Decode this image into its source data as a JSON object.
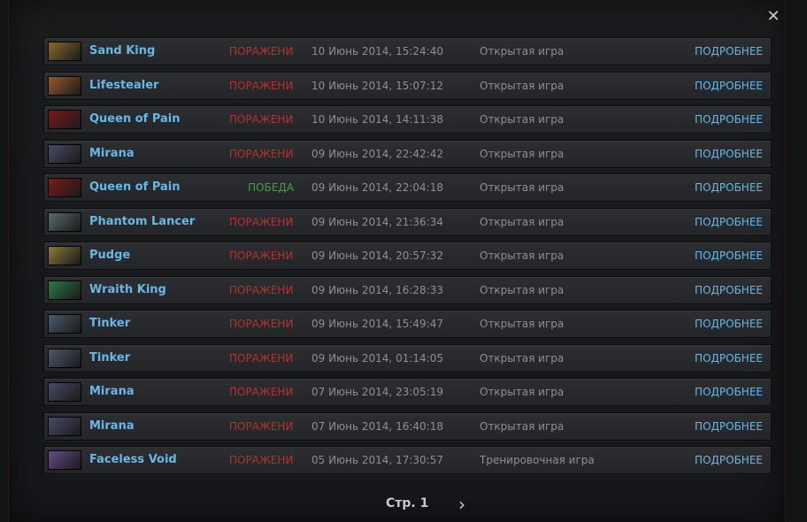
{
  "close_label": "✕",
  "rows": [
    {
      "hero": "Sand King",
      "result": "ПОРАЖЕНИЕ",
      "outcome": "loss",
      "date": "10 Июнь 2014, 15:24:40",
      "mode": "Открытая игра",
      "details": "ПОДРОБНЕЕ",
      "portrait_color": "#8a6a2a"
    },
    {
      "hero": "Lifestealer",
      "result": "ПОРАЖЕНИЕ",
      "outcome": "loss",
      "date": "10 Июнь 2014, 15:07:12",
      "mode": "Открытая игра",
      "details": "ПОДРОБНЕЕ",
      "portrait_color": "#9a5a2a"
    },
    {
      "hero": "Queen of Pain",
      "result": "ПОРАЖЕНИЕ",
      "outcome": "loss",
      "date": "10 Июнь 2014, 14:11:38",
      "mode": "Открытая игра",
      "details": "ПОДРОБНЕЕ",
      "portrait_color": "#7a1a1a"
    },
    {
      "hero": "Mirana",
      "result": "ПОРАЖЕНИЕ",
      "outcome": "loss",
      "date": "09 Июнь 2014, 22:42:42",
      "mode": "Открытая игра",
      "details": "ПОДРОБНЕЕ",
      "portrait_color": "#4a4a6a"
    },
    {
      "hero": "Queen of Pain",
      "result": "ПОБЕДА",
      "outcome": "win",
      "date": "09 Июнь 2014, 22:04:18",
      "mode": "Открытая игра",
      "details": "ПОДРОБНЕЕ",
      "portrait_color": "#7a1a1a"
    },
    {
      "hero": "Phantom Lancer",
      "result": "ПОРАЖЕНИЕ",
      "outcome": "loss",
      "date": "09 Июнь 2014, 21:36:34",
      "mode": "Открытая игра",
      "details": "ПОДРОБНЕЕ",
      "portrait_color": "#5a6a6a"
    },
    {
      "hero": "Pudge",
      "result": "ПОРАЖЕНИЕ",
      "outcome": "loss",
      "date": "09 Июнь 2014, 20:57:32",
      "mode": "Открытая игра",
      "details": "ПОДРОБНЕЕ",
      "portrait_color": "#8a7a3a"
    },
    {
      "hero": "Wraith King",
      "result": "ПОРАЖЕНИЕ",
      "outcome": "loss",
      "date": "09 Июнь 2014, 16:28:33",
      "mode": "Открытая игра",
      "details": "ПОДРОБНЕЕ",
      "portrait_color": "#2a7a4a"
    },
    {
      "hero": "Tinker",
      "result": "ПОРАЖЕНИЕ",
      "outcome": "loss",
      "date": "09 Июнь 2014, 15:49:47",
      "mode": "Открытая игра",
      "details": "ПОДРОБНЕЕ",
      "portrait_color": "#4a5a6a"
    },
    {
      "hero": "Tinker",
      "result": "ПОРАЖЕНИЕ",
      "outcome": "loss",
      "date": "09 Июнь 2014, 01:14:05",
      "mode": "Открытая игра",
      "details": "ПОДРОБНЕЕ",
      "portrait_color": "#4a5a6a"
    },
    {
      "hero": "Mirana",
      "result": "ПОРАЖЕНИЕ",
      "outcome": "loss",
      "date": "07 Июнь 2014, 23:05:19",
      "mode": "Открытая игра",
      "details": "ПОДРОБНЕЕ",
      "portrait_color": "#4a4a6a"
    },
    {
      "hero": "Mirana",
      "result": "ПОРАЖЕНИЕ",
      "outcome": "loss",
      "date": "07 Июнь 2014, 16:40:18",
      "mode": "Открытая игра",
      "details": "ПОДРОБНЕЕ",
      "portrait_color": "#4a4a6a"
    },
    {
      "hero": "Faceless Void",
      "result": "ПОРАЖЕНИЕ",
      "outcome": "loss",
      "date": "05 Июнь 2014, 17:30:57",
      "mode": "Тренировочная игра",
      "details": "ПОДРОБНЕЕ",
      "portrait_color": "#6a4a8a"
    }
  ],
  "pager": {
    "label": "Стр. 1",
    "next_icon": "chevron-right-icon",
    "next_glyph": "›"
  }
}
